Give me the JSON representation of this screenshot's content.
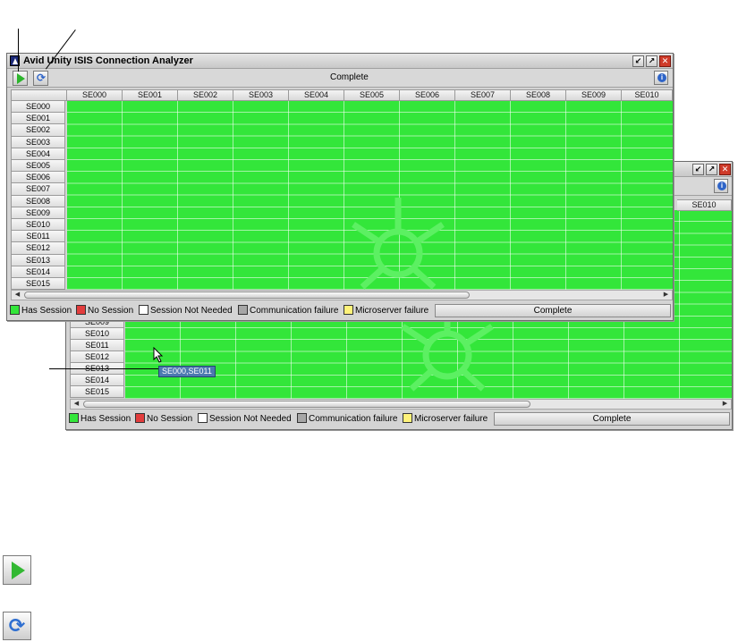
{
  "front_window": {
    "title": "Avid Unity ISIS Connection Analyzer",
    "toolbar_status": "Complete",
    "window_buttons": [
      "↙",
      "↗",
      "✕"
    ],
    "columns": [
      "SE000",
      "SE001",
      "SE002",
      "SE003",
      "SE004",
      "SE005",
      "SE006",
      "SE007",
      "SE008",
      "SE009",
      "SE010"
    ],
    "rows": [
      "SE000",
      "SE001",
      "SE002",
      "SE003",
      "SE004",
      "SE005",
      "SE006",
      "SE007",
      "SE008",
      "SE009",
      "SE010",
      "SE011",
      "SE012",
      "SE013",
      "SE014",
      "SE015"
    ],
    "legend_status": "Complete"
  },
  "back_window": {
    "window_buttons": [
      "↙",
      "↗",
      "✕"
    ],
    "last_column": "SE010",
    "rows": [
      "SE009",
      "SE010",
      "SE011",
      "SE012",
      "SE013",
      "SE014",
      "SE015"
    ],
    "tooltip": "SE000,SE011",
    "legend_status": "Complete"
  },
  "legend": {
    "items": [
      {
        "label": "Has Session",
        "color": "#33e63a"
      },
      {
        "label": "No Session",
        "color": "#e23c3c"
      },
      {
        "label": "Session Not Needed",
        "color": "#ffffff"
      },
      {
        "label": "Communication failure",
        "color": "#a6a6a6"
      },
      {
        "label": "Microserver failure",
        "color": "#fff27a"
      }
    ]
  },
  "icons": {
    "start": "play-icon",
    "refresh": "refresh-icon",
    "info": "info-icon",
    "scroll_left": "◀",
    "scroll_right": "▶",
    "refresh_glyph": "⟳"
  },
  "colors": {
    "grid_green": "#33e63a",
    "chrome": "#d4d4d4",
    "tooltip_bg": "#4c79b0"
  }
}
